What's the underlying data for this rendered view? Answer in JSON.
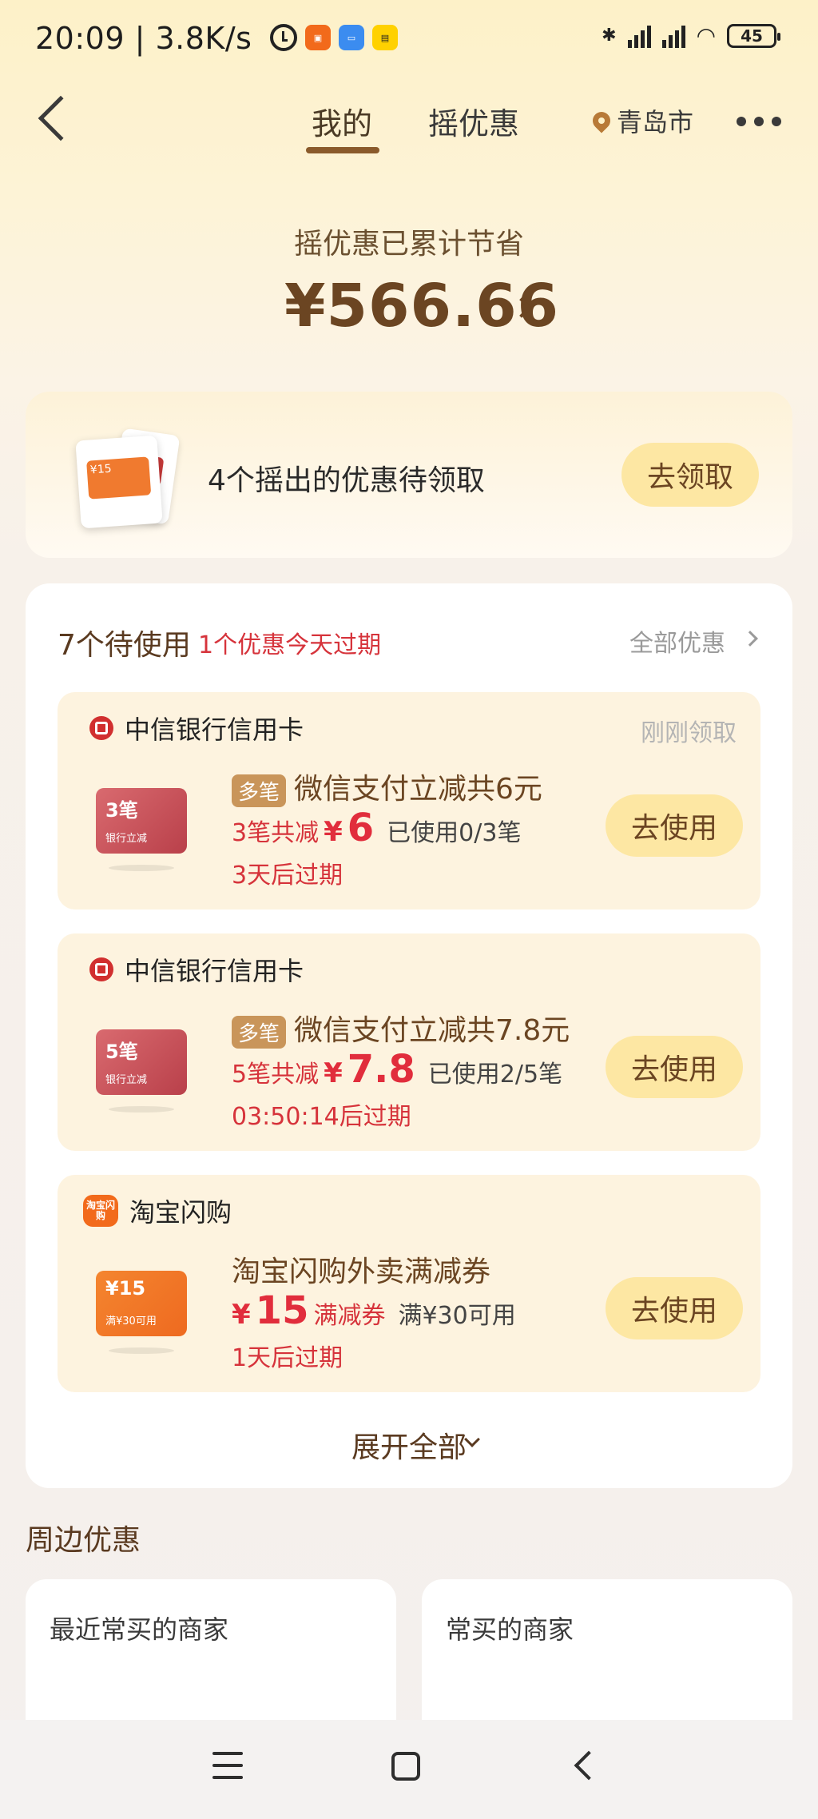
{
  "status_bar": {
    "time": "20:09",
    "speed": "3.8K/s",
    "battery": "45"
  },
  "nav": {
    "tab_mine": "我的",
    "tab_shake": "摇优惠",
    "location": "青岛市"
  },
  "savings": {
    "label": "摇优惠已累计节省",
    "amount": "¥566.66"
  },
  "pending": {
    "text": "4个摇出的优惠待领取",
    "button": "去领取"
  },
  "coupons": {
    "title": "7个待使用",
    "expiring": "1个优惠今天过期",
    "all_label": "全部优惠",
    "items": [
      {
        "brand": "中信银行信用卡",
        "note": "刚刚领取",
        "img_big": "3笔",
        "img_small": "银行立减",
        "tag": "多笔",
        "title": "微信支付立减共6元",
        "prefix": "3笔共减",
        "yen": "¥",
        "amount": "6",
        "used": "已使用0/3笔",
        "expire": "3天后过期",
        "button": "去使用"
      },
      {
        "brand": "中信银行信用卡",
        "note": "",
        "img_big": "5笔",
        "img_small": "银行立减",
        "tag": "多笔",
        "title": "微信支付立减共7.8元",
        "prefix": "5笔共减",
        "yen": "¥",
        "amount": "7.8",
        "used": "已使用2/5笔",
        "expire": "03:50:14后过期",
        "button": "去使用"
      },
      {
        "brand": "淘宝闪购",
        "brand_logo": "淘宝闪购",
        "note": "",
        "img_big": "¥15",
        "img_small": "满¥30可用",
        "title": "淘宝闪购外卖满减券",
        "yen": "¥",
        "amount": "15",
        "suffix": "满减券",
        "used": "满¥30可用",
        "expire": "1天后过期",
        "button": "去使用"
      }
    ],
    "expand": "展开全部"
  },
  "nearby": {
    "title": "周边优惠",
    "shop_left": "最近常买的商家",
    "shop_right": "常买的商家"
  },
  "colors": {
    "accent_brown": "#6b4522",
    "red": "#d6333b",
    "button_yellow": "#fde7a3"
  }
}
